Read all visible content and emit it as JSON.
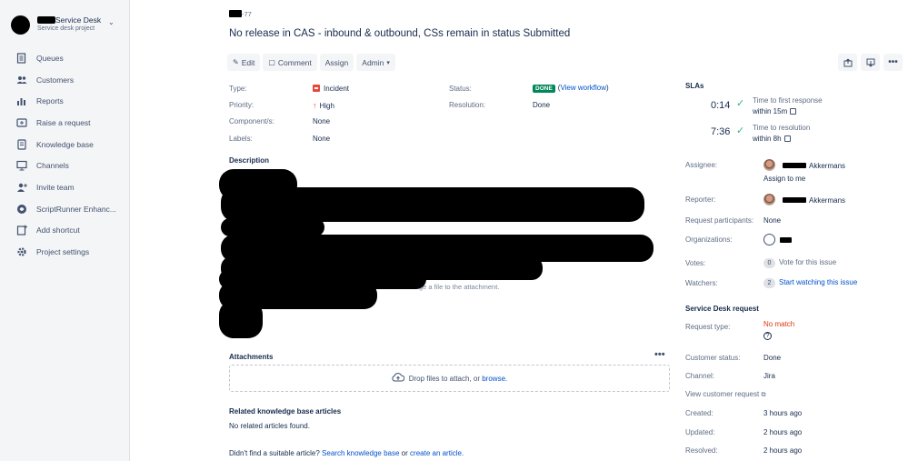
{
  "project": {
    "name_suffix": "Service Desk",
    "type": "Service desk project"
  },
  "nav": [
    {
      "label": "Queues",
      "icon": "queues-icon"
    },
    {
      "label": "Customers",
      "icon": "customers-icon"
    },
    {
      "label": "Reports",
      "icon": "reports-icon"
    },
    {
      "label": "Raise a request",
      "icon": "raise-request-icon"
    },
    {
      "label": "Knowledge base",
      "icon": "knowledge-base-icon"
    },
    {
      "label": "Channels",
      "icon": "channels-icon"
    },
    {
      "label": "Invite team",
      "icon": "invite-team-icon"
    },
    {
      "label": "ScriptRunner Enhanc...",
      "icon": "scriptrunner-icon"
    },
    {
      "label": "Add shortcut",
      "icon": "add-shortcut-icon"
    },
    {
      "label": "Project settings",
      "icon": "settings-icon"
    }
  ],
  "issue": {
    "key_suffix": "-77",
    "title": "No release in CAS - inbound & outbound, CSs remain in status Submitted"
  },
  "toolbar": {
    "edit": "Edit",
    "comment": "Comment",
    "assign": "Assign",
    "admin": "Admin"
  },
  "details": {
    "type_label": "Type:",
    "type_value": "Incident",
    "priority_label": "Priority:",
    "priority_value": "High",
    "components_label": "Component/s:",
    "components_value": "None",
    "labels_label": "Labels:",
    "labels_value": "None",
    "status_label": "Status:",
    "status_value": "DONE",
    "view_workflow": "View workflow",
    "resolution_label": "Resolution:",
    "resolution_value": "Done"
  },
  "description": {
    "heading": "Description",
    "visible_fragment": "ge a file to the attachment."
  },
  "attachments": {
    "heading": "Attachments",
    "drop_text": "Drop files to attach, or",
    "browse": "browse."
  },
  "kb": {
    "heading": "Related knowledge base articles",
    "empty": "No related articles found.",
    "footer_prefix": "Didn't find a suitable article?",
    "search_link": "Search knowledge base",
    "or": "or",
    "create_link": "create an article."
  },
  "sla": {
    "heading": "SLAs",
    "items": [
      {
        "time": "0:14",
        "name": "Time to first response",
        "target": "within 15m"
      },
      {
        "time": "7:36",
        "name": "Time to resolution",
        "target": "within 8h"
      }
    ]
  },
  "people": {
    "assignee_label": "Assignee:",
    "assignee_name": "Akkermans",
    "assign_to_me": "Assign to me",
    "reporter_label": "Reporter:",
    "reporter_name": "Akkermans",
    "participants_label": "Request participants:",
    "participants_value": "None",
    "organizations_label": "Organizations:",
    "votes_label": "Votes:",
    "votes_count": "0",
    "votes_link": "Vote for this issue",
    "watchers_label": "Watchers:",
    "watchers_count": "2",
    "watchers_link": "Start watching this issue"
  },
  "service_desk": {
    "heading": "Service Desk request",
    "request_type_label": "Request type:",
    "request_type_value": "No match",
    "customer_status_label": "Customer status:",
    "customer_status_value": "Done",
    "channel_label": "Channel:",
    "channel_value": "Jira",
    "view_request": "View customer request"
  },
  "dates": {
    "created_label": "Created:",
    "created_value": "3 hours ago",
    "updated_label": "Updated:",
    "updated_value": "2 hours ago",
    "resolved_label": "Resolved:",
    "resolved_value": "2 hours ago"
  },
  "colors": {
    "accent": "#0052cc",
    "done": "#00875a",
    "danger": "#de350b",
    "sla_ok": "#36b37e"
  }
}
